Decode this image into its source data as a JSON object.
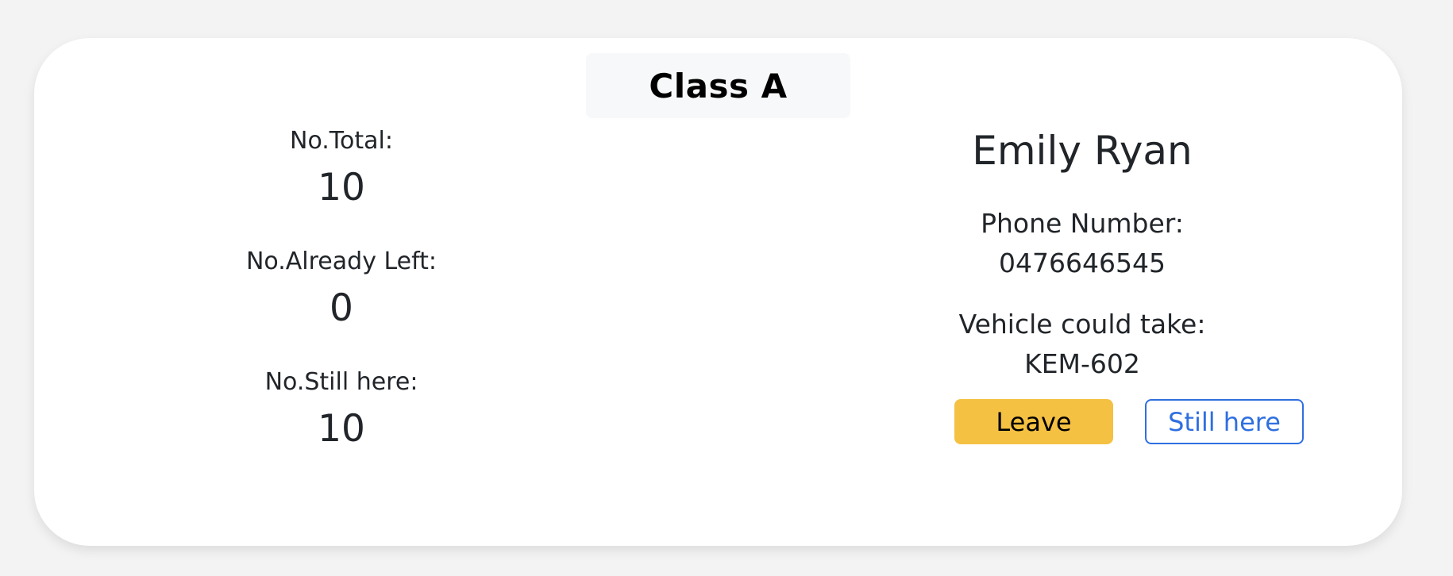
{
  "card": {
    "title": "Class A"
  },
  "stats": {
    "total_label": "No.Total:",
    "total_value": "10",
    "left_label": "No.Already Left:",
    "left_value": "0",
    "still_label": "No.Still here:",
    "still_value": "10"
  },
  "person": {
    "name": "Emily Ryan",
    "phone_label": "Phone Number:",
    "phone_value": "0476646545",
    "vehicle_label": "Vehicle could take:",
    "vehicle_value": "KEM-602"
  },
  "actions": {
    "leave_label": "Leave",
    "still_here_label": "Still here"
  },
  "colors": {
    "page_background": "#f3f3f3",
    "card_background": "#ffffff",
    "leave_button": "#f5c142",
    "still_here_button": "#2f6fe0"
  }
}
